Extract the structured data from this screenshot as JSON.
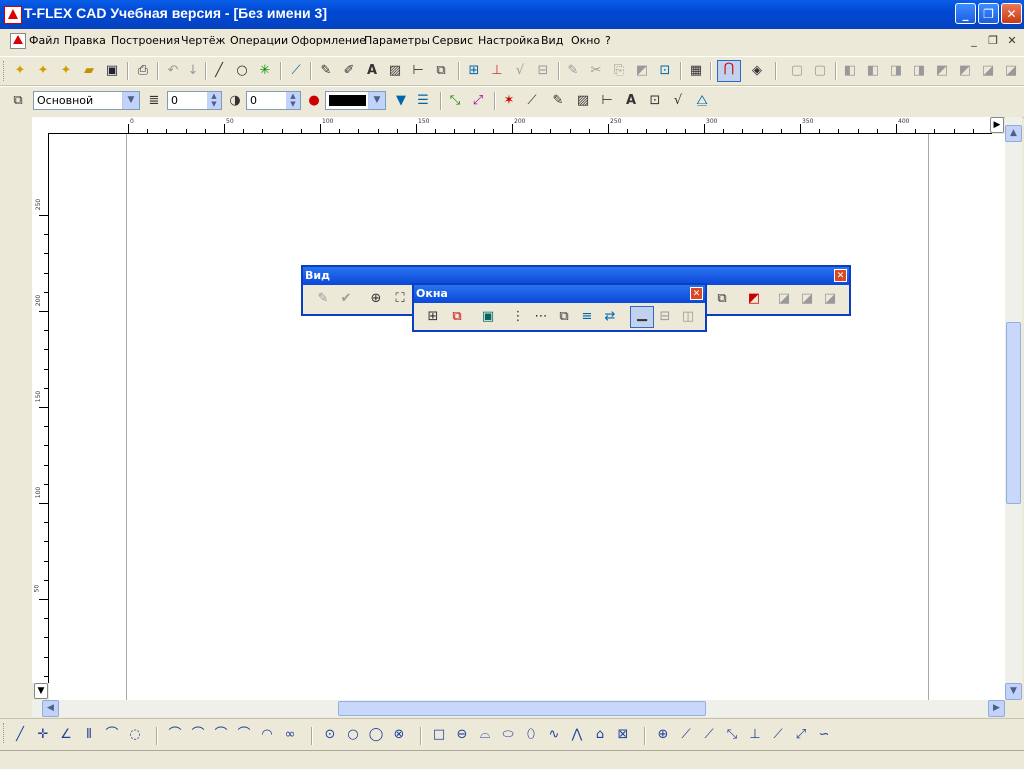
{
  "window": {
    "title": "T-FLEX CAD Учебная версия - [Без имени 3]",
    "minimize": "_",
    "restore": "❐",
    "close": "✕"
  },
  "menu": {
    "items": [
      "Файл",
      "Правка",
      "Построения",
      "Чертёж",
      "Операции",
      "Оформление",
      "Параметры",
      "Сервис",
      "Настройка",
      "Вид",
      "Окно",
      "?"
    ],
    "mdi_minimize": "_",
    "mdi_restore": "❐",
    "mdi_close": "✕"
  },
  "props": {
    "layer_value": "Основной",
    "level_value": "0",
    "priority_value": "0",
    "color_value": "#000000"
  },
  "ruler": {
    "h_labels": [
      "0",
      "50",
      "100",
      "150",
      "200",
      "250",
      "300",
      "350",
      "400"
    ],
    "v_labels": [
      "250",
      "200",
      "150",
      "100",
      "50"
    ]
  },
  "panels": {
    "vid_title": "Вид",
    "okna_title": "Окна",
    "close": "✕"
  },
  "colors": {
    "titlebar": "#0148d4",
    "panel_border": "#0a3fc4",
    "scroll": "#c1d3fb"
  }
}
